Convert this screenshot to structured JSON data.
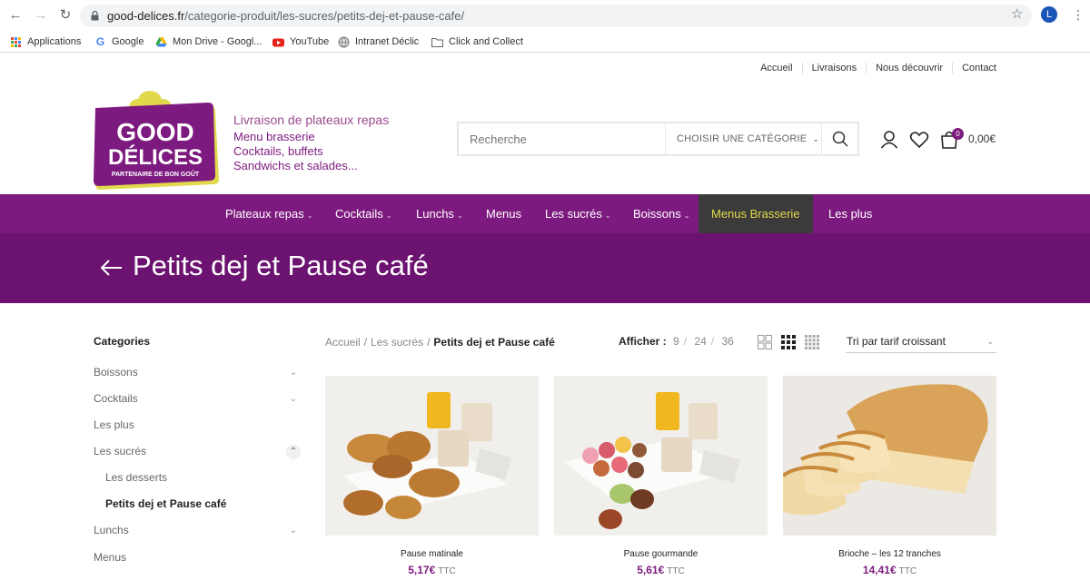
{
  "browser": {
    "url_host": "good-delices.fr",
    "url_path": "/categorie-produit/les-sucres/petits-dej-et-pause-cafe/",
    "profile_initial": "L",
    "bookmarks": [
      "Applications",
      "Google",
      "Mon Drive - Googl...",
      "YouTube",
      "Intranet Déclic",
      "Click and Collect"
    ]
  },
  "site": {
    "top_links": [
      "Accueil",
      "Livraisons",
      "Nous découvrir",
      "Contact"
    ],
    "logo": {
      "line1": "GOOD",
      "line2": "DÉLICES",
      "line3": "PARTENAIRE DE BON GOÛT"
    },
    "tagline": {
      "lead": "Livraison de plateaux repas",
      "lines": [
        "Menu brasserie",
        "Cocktails, buffets",
        "Sandwichs et salades..."
      ]
    },
    "search": {
      "placeholder": "Recherche",
      "category_label": "CHOISIR UNE CATÉGORIE"
    },
    "cart": {
      "count": "0",
      "total": "0,00€"
    },
    "nav": [
      {
        "label": "Plateaux repas",
        "has_caret": true
      },
      {
        "label": "Cocktails",
        "has_caret": true
      },
      {
        "label": "Lunchs",
        "has_caret": true
      },
      {
        "label": "Menus",
        "has_caret": false
      },
      {
        "label": "Les sucrés",
        "has_caret": true
      },
      {
        "label": "Boissons",
        "has_caret": true
      },
      {
        "label": "Menus Brasserie",
        "has_caret": false,
        "active": true
      },
      {
        "label": "Les plus",
        "has_caret": false
      }
    ],
    "colors": {
      "brand": "#7d1a7f",
      "active_nav_bg": "#3b3b3b",
      "active_nav_text": "#e1d94b"
    }
  },
  "page": {
    "title": "Petits dej et Pause café",
    "sidebar": {
      "title": "Categories",
      "items": [
        {
          "label": "Boissons",
          "expandable": true
        },
        {
          "label": "Cocktails",
          "expandable": true
        },
        {
          "label": "Les plus",
          "expandable": false
        },
        {
          "label": "Les sucrés",
          "expandable": true,
          "open": true
        },
        {
          "label": "Les desserts",
          "sub": true
        },
        {
          "label": "Petits dej et Pause café",
          "sub": true,
          "current": true
        },
        {
          "label": "Lunchs",
          "expandable": true
        },
        {
          "label": "Menus",
          "expandable": false
        }
      ]
    },
    "breadcrumb": [
      "Accueil",
      "Les sucrés",
      "Petits dej et Pause café"
    ],
    "afficher": {
      "label": "Afficher :",
      "options": [
        "9",
        "24",
        "36"
      ]
    },
    "sort": "Tri par tarif croissant",
    "products": [
      {
        "name": "Pause matinale",
        "price": "5,17€",
        "suffix": "TTC"
      },
      {
        "name": "Pause gourmande",
        "price": "5,61€",
        "suffix": "TTC"
      },
      {
        "name": "Brioche – les 12 tranches",
        "price": "14,41€",
        "suffix": "TTC"
      }
    ]
  }
}
